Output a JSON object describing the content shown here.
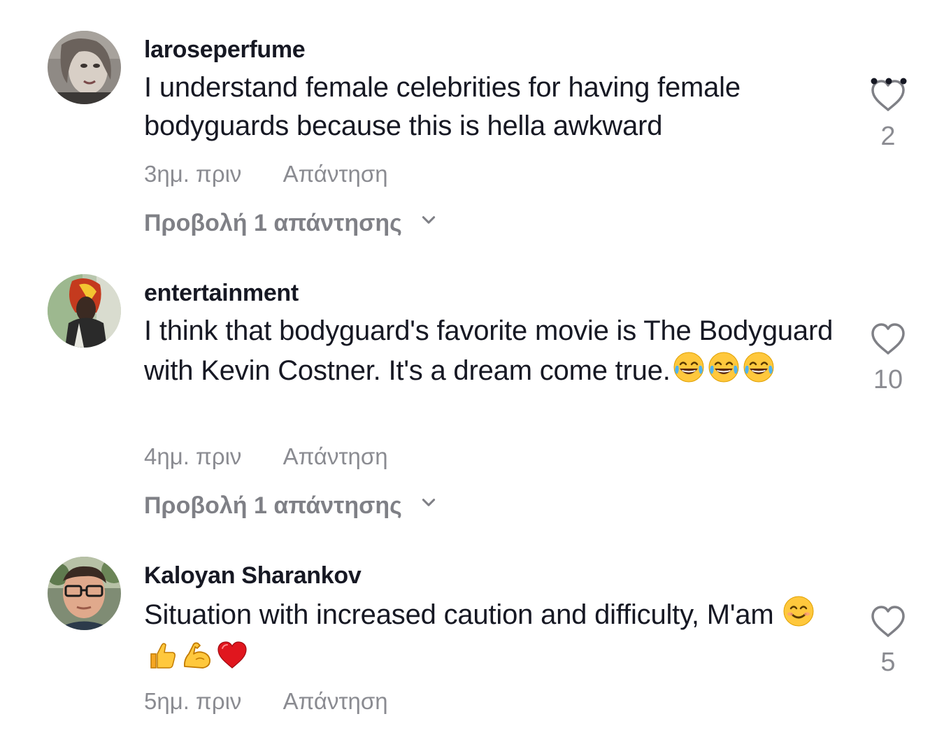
{
  "colors": {
    "text_primary": "#161823",
    "text_secondary": "rgba(22,24,35,0.5)",
    "background": "#ffffff"
  },
  "icons": {
    "more": "more-horizontal-icon",
    "like": "heart-outline-icon",
    "expand": "chevron-down-icon"
  },
  "comments": [
    {
      "username": "laroseperfume",
      "text": "I understand female celebrities for having female bodyguards because this is hella awkward",
      "emojis": [],
      "time": "3ημ. πριν",
      "reply_label": "Απάντηση",
      "view_replies": "Προβολή 1 απάντησης",
      "likes": "2"
    },
    {
      "username": "entertainment",
      "text": "I think that bodyguard's favorite movie is The Bodyguard with Kevin Costner. It's a dream come true.",
      "emojis": [
        "joy-emoji",
        "joy-emoji",
        "joy-emoji"
      ],
      "time": "4ημ. πριν",
      "reply_label": "Απάντηση",
      "view_replies": "Προβολή 1 απάντησης",
      "likes": "10"
    },
    {
      "username": "Kaloyan Sharankov",
      "text": "Situation with increased caution and difficulty, M'am",
      "emojis": [
        "smiling-emoji",
        "thumbs-up-emoji",
        "flexed-biceps-emoji",
        "red-heart-emoji"
      ],
      "time": "5ημ. πριν",
      "reply_label": "Απάντηση",
      "likes": "5"
    }
  ]
}
